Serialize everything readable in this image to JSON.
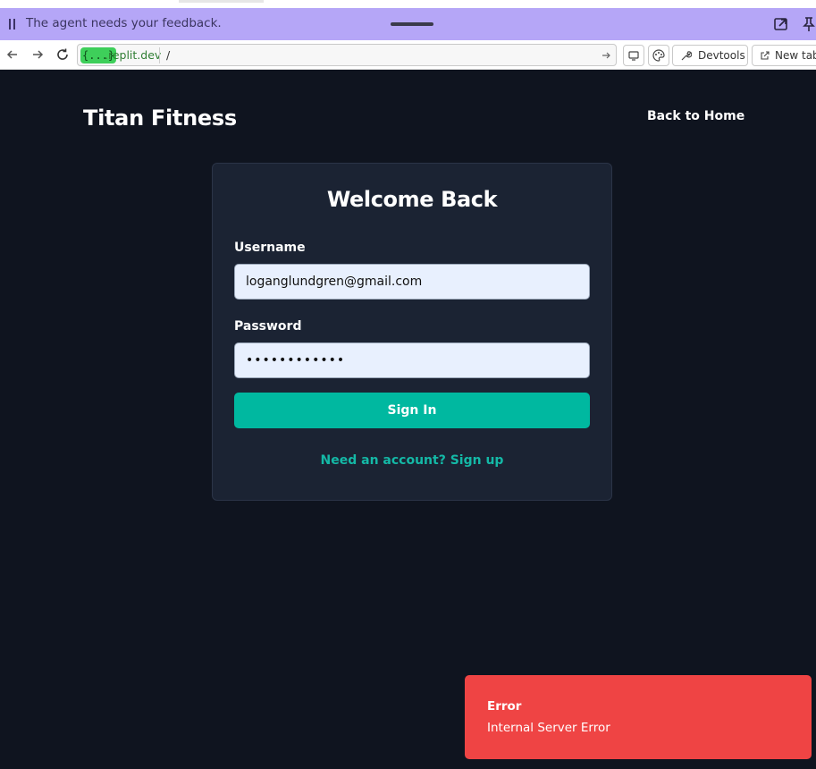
{
  "agent_banner": {
    "message": "The agent needs your feedback."
  },
  "url_bar": {
    "host_chip": "{...}",
    "domain": ".replit.dev",
    "path": "/",
    "devtools_label": "Devtools",
    "new_tab_label": "New tab"
  },
  "header": {
    "brand": "Titan Fitness",
    "back_home": "Back to Home"
  },
  "login_card": {
    "title": "Welcome Back",
    "username_label": "Username",
    "username_value": "loganglundgren@gmail.com",
    "password_label": "Password",
    "password_value": "••••••••••••",
    "signin_label": "Sign In",
    "signup_link": "Need an account? Sign up"
  },
  "toast": {
    "title": "Error",
    "message": "Internal Server Error"
  },
  "colors": {
    "page_bg": "#0f141f",
    "card_bg": "#1b2333",
    "accent": "#00b8a0",
    "banner": "#b5a6f7",
    "error": "#ef4444"
  }
}
